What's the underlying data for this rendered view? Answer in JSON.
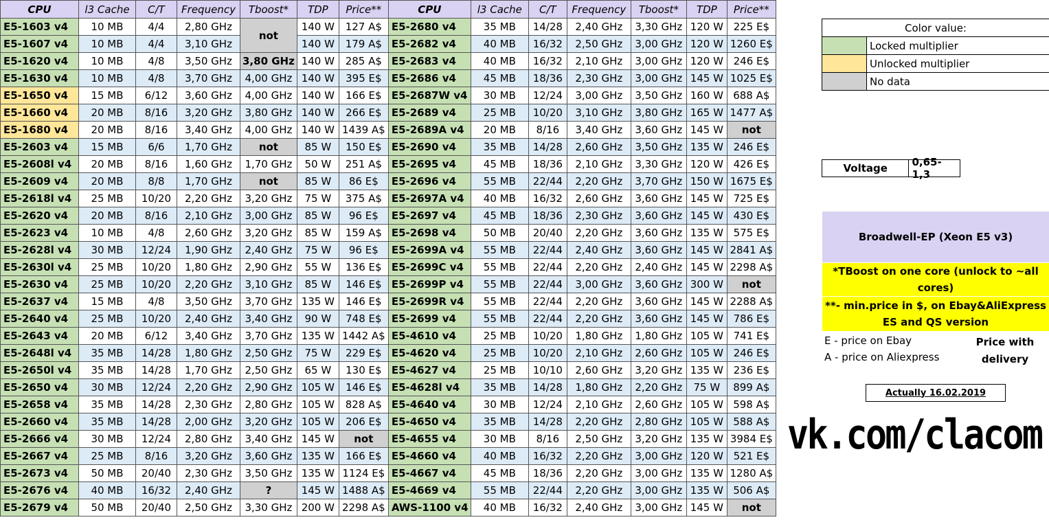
{
  "headers": [
    "CPU",
    "l3 Cache",
    "C/T",
    "Frequency",
    "Tboost*",
    "TDP",
    "Price**",
    "CPU",
    "l3 Cache",
    "C/T",
    "Frequency",
    "Tboost*",
    "TDP",
    "Price**"
  ],
  "rows": [
    {
      "a": [
        "E5-1603  v4",
        "10 MB",
        "4/4",
        "2,80 GHz",
        "not",
        "140 W",
        "127 A$"
      ],
      "b": [
        "E5-2680 v4",
        "35 MB",
        "14/28",
        "2,40 GHz",
        "3,30 GHz",
        "120 W",
        "225 E$"
      ]
    },
    {
      "a": [
        "E5-1607  v4",
        "10 MB",
        "4/4",
        "3,10 GHz",
        "",
        "140 W",
        "179 A$"
      ],
      "b": [
        "E5-2682 v4",
        "40 MB",
        "16/32",
        "2,50 GHz",
        "3,00 GHz",
        "120 W",
        "1260 E$"
      ]
    },
    {
      "a": [
        "E5-1620 v4",
        "10 MB",
        "4/8",
        "3,50 GHz",
        "3,80 GHz",
        "140 W",
        "285 A$"
      ],
      "b": [
        "E5-2683 v4",
        "40 MB",
        "16/32",
        "2,10 GHz",
        "3,00 GHz",
        "120 W",
        "246 E$"
      ]
    },
    {
      "a": [
        "E5-1630 v4",
        "10 MB",
        "4/8",
        "3,70 GHz",
        "4,00 GHz",
        "140 W",
        "395 E$"
      ],
      "b": [
        "E5-2686 v4",
        "45 MB",
        "18/36",
        "2,30 GHz",
        "3,00 GHz",
        "145 W",
        "1025 E$"
      ]
    },
    {
      "a": [
        "E5-1650 v4",
        "15 MB",
        "6/12",
        "3,60 GHz",
        "4,00 GHz",
        "140 W",
        "166 E$"
      ],
      "b": [
        "E5-2687W v4",
        "30 MB",
        "12/24",
        "3,00 GHz",
        "3,50 GHz",
        "160 W",
        "688 A$"
      ]
    },
    {
      "a": [
        "E5-1660 v4",
        "20 MB",
        "8/16",
        "3,20 GHz",
        "3,80 GHz",
        "140 W",
        "266 E$"
      ],
      "b": [
        "E5-2689 v4",
        "25 MB",
        "10/20",
        "3,10 GHz",
        "3,80 GHz",
        "165 W",
        "1477 A$"
      ]
    },
    {
      "a": [
        "E5-1680 v4",
        "20 MB",
        "8/16",
        "3,40 GHz",
        "4,00 GHz",
        "140 W",
        "1439 A$"
      ],
      "b": [
        "E5-2689A v4",
        "20 MB",
        "8/16",
        "3,40 GHz",
        "3,60 GHz",
        "145 W",
        "not"
      ]
    },
    {
      "a": [
        "E5-2603 v4",
        "15 MB",
        "6/6",
        "1,70 GHz",
        "not",
        "85 W",
        "150 E$"
      ],
      "b": [
        "E5-2690 v4",
        "35 MB",
        "14/28",
        "2,60 GHz",
        "3,50 GHz",
        "135 W",
        "246 E$"
      ]
    },
    {
      "a": [
        "E5-2608l v4",
        "20 MB",
        "8/16",
        "1,60 GHz",
        "1,70 GHz",
        "50 W",
        "251 A$"
      ],
      "b": [
        "E5-2695 v4",
        "45 MB",
        "18/36",
        "2,10 GHz",
        "3,30 GHz",
        "120 W",
        "426 E$"
      ]
    },
    {
      "a": [
        "E5-2609 v4",
        "20 MB",
        "8/8",
        "1,70 GHz",
        "not",
        "85 W",
        "86 E$"
      ],
      "b": [
        "E5-2696 v4",
        "55 MB",
        "22/44",
        "2,20 GHz",
        "3,70 GHz",
        "150 W",
        "1675 E$"
      ]
    },
    {
      "a": [
        "E5-2618l v4",
        "25 MB",
        "10/20",
        "2,20 GHz",
        "3,20 GHz",
        "75 W",
        "375 A$"
      ],
      "b": [
        "E5-2697A v4",
        "40 MB",
        "16/32",
        "2,60 GHz",
        "3,60 GHz",
        "145 W",
        "725 E$"
      ]
    },
    {
      "a": [
        "E5-2620 v4",
        "20 MB",
        "8/16",
        "2,10 GHz",
        "3,00 GHz",
        "85 W",
        "96 E$"
      ],
      "b": [
        "E5-2697 v4",
        "45 MB",
        "18/36",
        "2,30 GHz",
        "3,60 GHz",
        "145 W",
        "430 E$"
      ]
    },
    {
      "a": [
        "E5-2623 v4",
        "10 MB",
        "4/8",
        "2,60 GHz",
        "3,20 GHz",
        "85 W",
        "159 A$"
      ],
      "b": [
        "E5-2698 v4",
        "50 MB",
        "20/40",
        "2,20 GHz",
        "3,60 GHz",
        "135 W",
        "575 E$"
      ]
    },
    {
      "a": [
        "E5-2628l v4",
        "30 MB",
        "12/24",
        "1,90 GHz",
        "2,40 GHz",
        "75 W",
        "96 E$"
      ],
      "b": [
        "E5-2699A v4",
        "55 MB",
        "22/44",
        "2,40 GHz",
        "3,60 GHz",
        "145 W",
        "2841 A$"
      ]
    },
    {
      "a": [
        "E5-2630l v4",
        "25 MB",
        "10/20",
        "1,80 GHz",
        "2,90 GHz",
        "55 W",
        "136 E$"
      ],
      "b": [
        "E5-2699C v4",
        "55 MB",
        "22/44",
        "2,20 GHz",
        "2,40 GHz",
        "145 W",
        "2298 A$"
      ]
    },
    {
      "a": [
        "E5-2630 v4",
        "25 MB",
        "10/20",
        "2,20 GHz",
        "3,10 GHz",
        "85 W",
        "146 E$"
      ],
      "b": [
        "E5-2699P v4",
        "55 MB",
        "22/44",
        "3,00 GHz",
        "3,60 GHz",
        "300 W",
        "not"
      ]
    },
    {
      "a": [
        "E5-2637 v4",
        "15 MB",
        "4/8",
        "3,50 GHz",
        "3,70 GHz",
        "135 W",
        "146 E$"
      ],
      "b": [
        "E5-2699R v4",
        "55 MB",
        "22/44",
        "2,20 GHz",
        "3,60 GHz",
        "145 W",
        "2288 A$"
      ]
    },
    {
      "a": [
        "E5-2640 v4",
        "25 MB",
        "10/20",
        "2,40 GHz",
        "3,40 GHz",
        "90 W",
        "748 E$"
      ],
      "b": [
        "E5-2699 v4",
        "55 MB",
        "22/44",
        "2,20 GHz",
        "3,60 GHz",
        "145 W",
        "786 E$"
      ]
    },
    {
      "a": [
        "E5-2643 v4",
        "20 MB",
        "6/12",
        "3,40 GHz",
        "3,70 GHz",
        "135 W",
        "1442 A$"
      ],
      "b": [
        "E5-4610 v4",
        "25 MB",
        "10/20",
        "1,80 GHz",
        "1,80 GHz",
        "105 W",
        "741 E$"
      ]
    },
    {
      "a": [
        "E5-2648l v4",
        "35 MB",
        "14/28",
        "1,80 GHz",
        "2,50 GHz",
        "75 W",
        "229 E$"
      ],
      "b": [
        "E5-4620 v4",
        "25 MB",
        "10/20",
        "2,10 GHz",
        "2,60 GHz",
        "105 W",
        "246 E$"
      ]
    },
    {
      "a": [
        "E5-2650l v4",
        "35 MB",
        "14/28",
        "1,70 GHz",
        "2,50 GHz",
        "65 W",
        "130 E$"
      ],
      "b": [
        "E5-4627 v4",
        "25 MB",
        "10/10",
        "2,60 GHz",
        "3,20 GHz",
        "135 W",
        "236 E$"
      ]
    },
    {
      "a": [
        "E5-2650 v4",
        "30 MB",
        "12/24",
        "2,20 GHz",
        "2,90 GHz",
        "105 W",
        "146 E$"
      ],
      "b": [
        "E5-4628l v4",
        "35 MB",
        "14/28",
        "1,80 GHz",
        "2,20 GHz",
        "75 W",
        "899 A$"
      ]
    },
    {
      "a": [
        "E5-2658 v4",
        "35 MB",
        "14/28",
        "2,30 GHz",
        "2,80 GHz",
        "105 W",
        "828 A$"
      ],
      "b": [
        "E5-4640 v4",
        "30 MB",
        "12/24",
        "2,10 GHz",
        "2,60 GHz",
        "105 W",
        "598 A$"
      ]
    },
    {
      "a": [
        "E5-2660 v4",
        "35 MB",
        "14/28",
        "2,00 GHz",
        "3,20 GHz",
        "105 W",
        "206 E$"
      ],
      "b": [
        "E5-4650 v4",
        "35 MB",
        "14/28",
        "2,20 GHz",
        "2,80 GHz",
        "105 W",
        "588 A$"
      ]
    },
    {
      "a": [
        "E5-2666 v4",
        "30 MB",
        "12/24",
        "2,80 GHz",
        "3,40 GHz",
        "145 W",
        "not"
      ],
      "b": [
        "E5-4655 v4",
        "30 MB",
        "8/16",
        "2,50 GHz",
        "3,20 GHz",
        "135 W",
        "3984 E$"
      ]
    },
    {
      "a": [
        "E5-2667 v4",
        "25 MB",
        "8/16",
        "3,20 GHz",
        "3,60 GHz",
        "135 W",
        "166 E$"
      ],
      "b": [
        "E5-4660 v4",
        "40 MB",
        "16/32",
        "2,20 GHz",
        "3,00 GHz",
        "120 W",
        "521 E$"
      ]
    },
    {
      "a": [
        "E5-2673 v4",
        "50 MB",
        "20/40",
        "2,30 GHz",
        "3,50 GHz",
        "135 W",
        "1124 E$"
      ],
      "b": [
        "E5-4667 v4",
        "45 MB",
        "18/36",
        "2,20 GHz",
        "3,00 GHz",
        "135 W",
        "1280 A$"
      ]
    },
    {
      "a": [
        "E5-2676 v4",
        "40 MB",
        "16/32",
        "2,40 GHz",
        "?",
        "145 W",
        "1488 A$"
      ],
      "b": [
        "E5-4669 v4",
        "55 MB",
        "22/44",
        "2,20 GHz",
        "3,00 GHz",
        "135 W",
        "506 A$"
      ]
    },
    {
      "a": [
        "E5-2679 v4",
        "50 MB",
        "20/40",
        "2,50 GHz",
        "3,30 GHz",
        "200 W",
        "2298 A$"
      ],
      "b": [
        "AWS-1100 v4",
        "40 MB",
        "16/32",
        "2,40 GHz",
        "3,00 GHz",
        "145 W",
        "not"
      ]
    }
  ],
  "unlocked_rows": [
    4,
    5,
    6
  ],
  "gray_cells": [
    {
      "row": 0,
      "side": "a",
      "col": 4
    },
    {
      "row": 2,
      "side": "a",
      "col": 4
    },
    {
      "row": 7,
      "side": "a",
      "col": 4
    },
    {
      "row": 9,
      "side": "a",
      "col": 4
    },
    {
      "row": 27,
      "side": "a",
      "col": 4
    },
    {
      "row": 24,
      "side": "a",
      "col": 6
    },
    {
      "row": 6,
      "side": "b",
      "col": 6
    },
    {
      "row": 15,
      "side": "b",
      "col": 6
    },
    {
      "row": 28,
      "side": "b",
      "col": 6
    }
  ],
  "colors": {
    "locked": "#c6e0b4",
    "unlocked": "#ffe699",
    "nodata": "#d0d0d0",
    "header": "#d9d2f2",
    "stripe": "#ddebf7",
    "note": "#ffff00"
  },
  "legend": {
    "title": "Color value:",
    "items": [
      {
        "label": "Locked multiplier",
        "color": "#c6e0b4"
      },
      {
        "label": "Unlocked multiplier",
        "color": "#ffe699"
      },
      {
        "label": "No data",
        "color": "#d0d0d0"
      }
    ]
  },
  "voltage": {
    "label": "Voltage",
    "value": "0,65-1,3"
  },
  "family": "Broadwell-EP (Xeon E5 v3)",
  "tboost_note": "*TBoost on one core (unlock to ~all cores)",
  "price_note": "**- min.price in $, on Ebay&AliExpress ES and QS version",
  "ebay_note": "E - price on Ebay",
  "ali_note": "A - price on Aliexpress",
  "delivery_note": "Price with delivery",
  "date": "Actually 16.02.2019",
  "site": "vk.com/clacom"
}
